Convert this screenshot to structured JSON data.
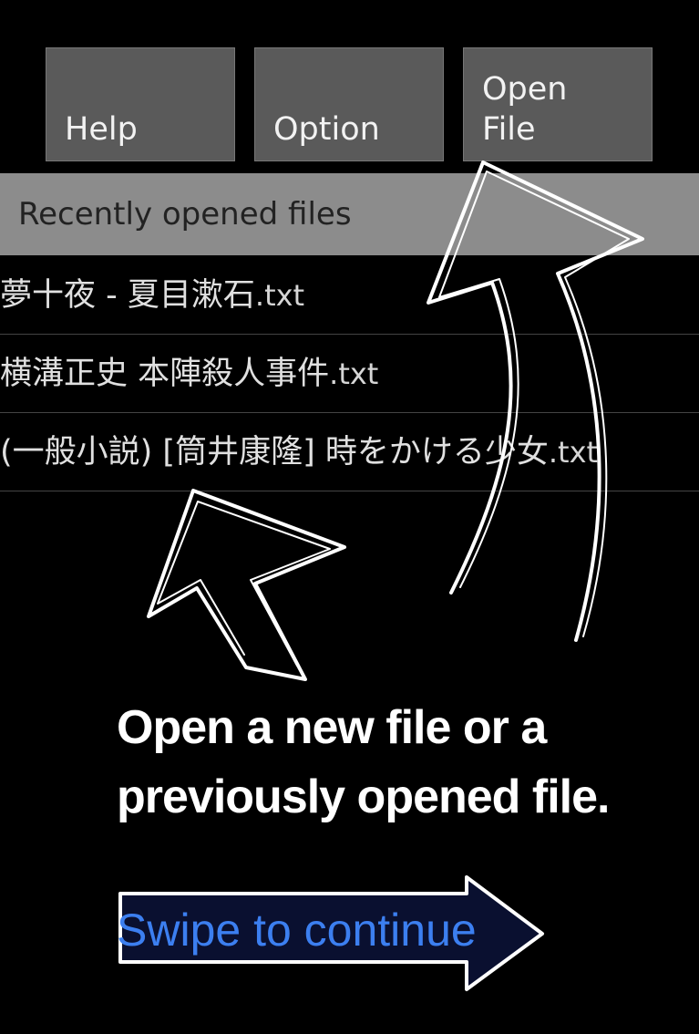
{
  "toolbar": {
    "help_label": "Help",
    "option_label": "Option",
    "open_line1": "Open",
    "open_line2": "File"
  },
  "recent": {
    "header": "Recently opened files",
    "files": [
      {
        "name": "夢十夜 - 夏目漱石",
        "ext": ".txt"
      },
      {
        "name": "横溝正史 本陣殺人事件",
        "ext": ".txt"
      },
      {
        "name": "(一般小説) [筒井康隆] 時をかける少女",
        "ext": ".txt"
      }
    ]
  },
  "tutorial": {
    "caption_line1": "Open a new file or a",
    "caption_line2": "previously opened file.",
    "swipe_hint": "Swipe to continue"
  },
  "colors": {
    "button_bg": "#5a5a5a",
    "header_bg": "#8c8c8c",
    "swipe_text": "#3c7ff0",
    "swipe_arrow_fill": "#0a1030"
  }
}
